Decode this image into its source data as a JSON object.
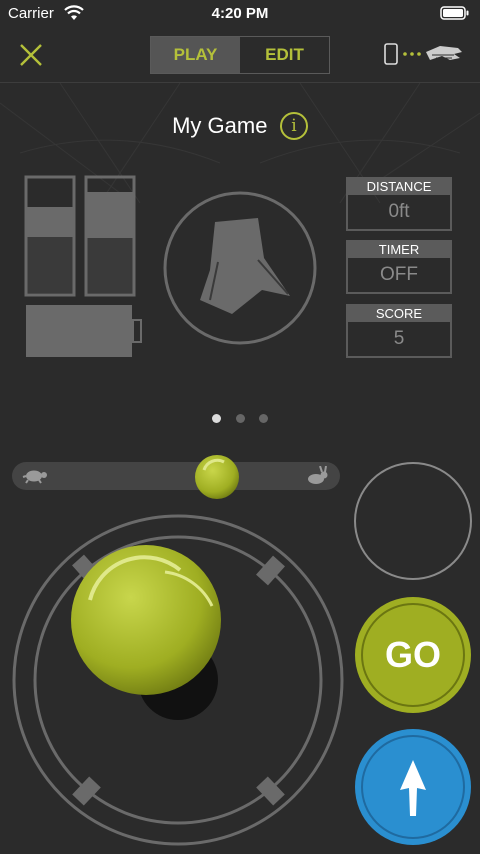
{
  "status_bar": {
    "carrier": "Carrier",
    "time": "4:20 PM"
  },
  "nav": {
    "mode_play": "PLAY",
    "mode_edit": "EDIT",
    "active_mode": "PLAY"
  },
  "header": {
    "title": "My Game",
    "info_glyph": "i"
  },
  "stats": [
    {
      "label": "DISTANCE",
      "value": "0ft"
    },
    {
      "label": "TIMER",
      "value": "OFF"
    },
    {
      "label": "SCORE",
      "value": "5"
    }
  ],
  "pager": {
    "pages": 3,
    "current": 1
  },
  "controls": {
    "go_label": "GO"
  },
  "colors": {
    "accent": "#b4c03a",
    "blue": "#2a8fd0",
    "background": "#2b2b2b"
  },
  "icons": [
    "close-icon",
    "device-connection-icon",
    "info-icon",
    "turtle-icon",
    "rabbit-icon",
    "up-arrow-icon"
  ]
}
